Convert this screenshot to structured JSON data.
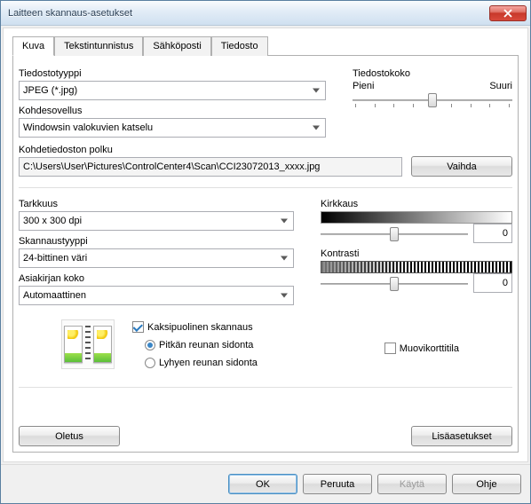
{
  "window": {
    "title": "Laitteen skannaus-asetukset"
  },
  "tabs": {
    "t0": "Kuva",
    "t1": "Tekstintunnistus",
    "t2": "Sähköposti",
    "t3": "Tiedosto"
  },
  "filetype": {
    "label": "Tiedostotyyppi",
    "value": "JPEG (*.jpg)"
  },
  "targetapp": {
    "label": "Kohdesovellus",
    "value": "Windowsin valokuvien katselu"
  },
  "targetpath": {
    "label": "Kohdetiedoston polku",
    "value": "C:\\Users\\User\\Pictures\\ControlCenter4\\Scan\\CCI23072013_xxxx.jpg"
  },
  "change_btn": "Vaihda",
  "filesize": {
    "label": "Tiedostokoko",
    "small": "Pieni",
    "large": "Suuri"
  },
  "resolution": {
    "label": "Tarkkuus",
    "value": "300 x 300 dpi"
  },
  "scantype": {
    "label": "Skannaustyyppi",
    "value": "24-bittinen väri"
  },
  "docsize": {
    "label": "Asiakirjan koko",
    "value": "Automaattinen"
  },
  "brightness": {
    "label": "Kirkkaus",
    "value": "0"
  },
  "contrast": {
    "label": "Kontrasti",
    "value": "0"
  },
  "duplex": {
    "label": "Kaksipuolinen skannaus",
    "long_edge": "Pitkän reunan sidonta",
    "short_edge": "Lyhyen reunan sidonta"
  },
  "plasticcard": {
    "label": "Muovikorttitila"
  },
  "default_btn": "Oletus",
  "advanced_btn": "Lisäasetukset",
  "footer": {
    "ok": "OK",
    "cancel": "Peruuta",
    "apply": "Käytä",
    "help": "Ohje"
  }
}
